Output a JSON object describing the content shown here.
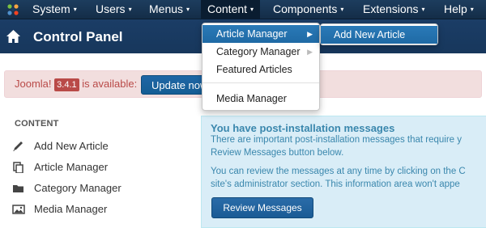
{
  "navbar": {
    "items": [
      {
        "label": "System"
      },
      {
        "label": "Users"
      },
      {
        "label": "Menus"
      },
      {
        "label": "Content"
      },
      {
        "label": "Components"
      },
      {
        "label": "Extensions"
      },
      {
        "label": "Help"
      }
    ],
    "caret": "▾"
  },
  "header": {
    "title": "Control Panel"
  },
  "alert": {
    "prefix": "Joomla!",
    "version": "3.4.1",
    "suffix": "is available:",
    "button_label": "Update now"
  },
  "sidebar": {
    "heading": "CONTENT",
    "items": [
      {
        "label": "Add New Article",
        "icon": "pencil-icon"
      },
      {
        "label": "Article Manager",
        "icon": "copy-icon"
      },
      {
        "label": "Category Manager",
        "icon": "folder-icon"
      },
      {
        "label": "Media Manager",
        "icon": "image-icon"
      }
    ]
  },
  "post_install": {
    "title": "You have post-installation messages",
    "lines": [
      "There are important post-installation messages that require y",
      "Review Messages button below.",
      "You can review the messages at any time by clicking on the C",
      "site's administrator section. This information area won't appe"
    ],
    "button_label": "Review Messages"
  },
  "content_menu": {
    "items": [
      {
        "label": "Article Manager"
      },
      {
        "label": "Category Manager"
      },
      {
        "label": "Featured Articles"
      },
      {
        "label": "Media Manager"
      }
    ],
    "submenu_arrow": "▶",
    "submenu": {
      "label": "Add New Article"
    }
  },
  "colors": {
    "navbar": "#1d3d5e",
    "header": "#1b3d66",
    "highlight": "#2a7ab8",
    "alert_text": "#b94a48",
    "info_text": "#3a87ad"
  }
}
